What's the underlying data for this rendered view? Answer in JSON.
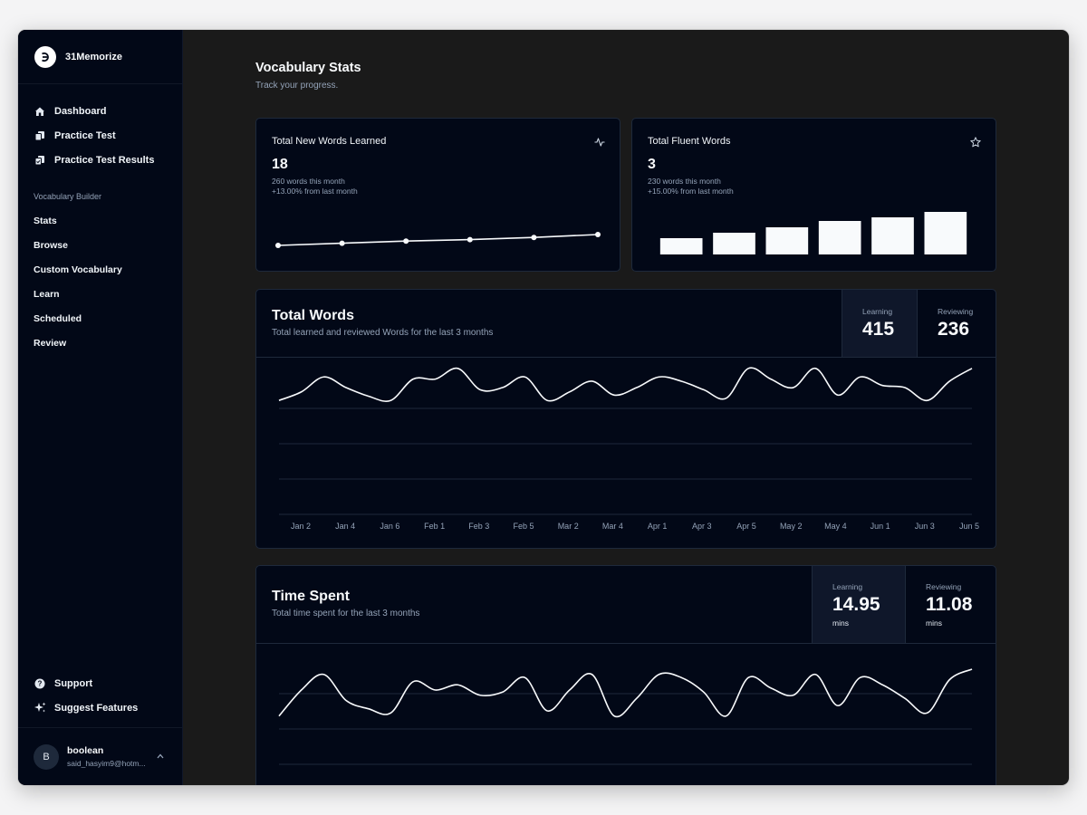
{
  "app": {
    "name": "31Memorize"
  },
  "sidebar": {
    "main_items": [
      {
        "label": "Dashboard",
        "icon": "home-icon"
      },
      {
        "label": "Practice Test",
        "icon": "files-icon"
      },
      {
        "label": "Practice Test Results",
        "icon": "file-check-icon"
      }
    ],
    "section_label": "Vocabulary Builder",
    "vocab_items": [
      "Stats",
      "Browse",
      "Custom Vocabulary",
      "Learn",
      "Scheduled",
      "Review"
    ],
    "bottom_items": [
      {
        "label": "Support",
        "icon": "help-circle-icon"
      },
      {
        "label": "Suggest Features",
        "icon": "sparkles-icon"
      }
    ]
  },
  "user": {
    "initial": "B",
    "name": "boolean",
    "email": "said_hasyim9@hotm..."
  },
  "page": {
    "title": "Vocabulary Stats",
    "subtitle": "Track your progress."
  },
  "cards": {
    "new_words": {
      "title": "Total New Words Learned",
      "value": "18",
      "note1": "260 words this month",
      "note2": "+13.00% from last month",
      "icon": "activity-icon"
    },
    "fluent_words": {
      "title": "Total Fluent Words",
      "value": "3",
      "note1": "230 words this month",
      "note2": "+15.00% from last month",
      "icon": "star-icon"
    }
  },
  "total_words": {
    "title": "Total Words",
    "subtitle": "Total learned and reviewed Words for the last 3 months",
    "learning_label": "Learning",
    "learning_value": "415",
    "reviewing_label": "Reviewing",
    "reviewing_value": "236"
  },
  "time_spent": {
    "title": "Time Spent",
    "subtitle": "Total time spent for the last 3 months",
    "learning_label": "Learning",
    "learning_value": "14.95",
    "learning_unit": "mins",
    "reviewing_label": "Reviewing",
    "reviewing_value": "11.08",
    "reviewing_unit": "mins"
  },
  "chart_data": [
    {
      "type": "line",
      "x": [
        1,
        2,
        3,
        4,
        5,
        6
      ],
      "values": [
        10,
        13,
        16,
        18,
        21,
        25
      ],
      "ylim": [
        0,
        100
      ]
    },
    {
      "type": "bar",
      "categories": [
        "1",
        "2",
        "3",
        "4",
        "5",
        "6"
      ],
      "values": [
        18,
        24,
        30,
        37,
        41,
        47
      ],
      "ylim": [
        0,
        50
      ]
    },
    {
      "type": "line",
      "x_ticks": [
        "Jan 2",
        "Jan 4",
        "Jan 6",
        "Feb 1",
        "Feb 3",
        "Feb 5",
        "Mar 2",
        "Mar 4",
        "Apr 1",
        "Apr 3",
        "Apr 5",
        "May 2",
        "May 4",
        "Jun 1",
        "Jun 3",
        "Jun 5"
      ],
      "values": [
        60,
        68,
        82,
        72,
        64,
        60,
        80,
        80,
        90,
        70,
        72,
        82,
        60,
        68,
        78,
        65,
        72,
        82,
        78,
        70,
        62,
        90,
        80,
        72,
        90,
        65,
        82,
        74,
        72,
        60,
        78,
        90
      ],
      "ylim": [
        0,
        100
      ],
      "grid": true
    },
    {
      "type": "line",
      "values": [
        35,
        60,
        75,
        50,
        42,
        38,
        68,
        60,
        65,
        55,
        58,
        72,
        40,
        60,
        75,
        35,
        52,
        75,
        72,
        58,
        35,
        72,
        62,
        55,
        75,
        45,
        72,
        65,
        52,
        38,
        70,
        80
      ],
      "ylim": [
        0,
        100
      ],
      "grid": true
    }
  ]
}
